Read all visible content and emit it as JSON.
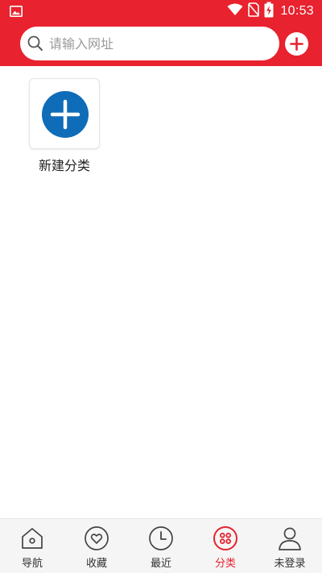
{
  "status_bar": {
    "time": "10:53",
    "icons": [
      "image-notification-icon",
      "wifi-icon",
      "no-sim-icon",
      "battery-charging-icon"
    ]
  },
  "search": {
    "placeholder": "请输入网址"
  },
  "content": {
    "new_category_label": "新建分类"
  },
  "bottom_nav": {
    "items": [
      {
        "label": "导航",
        "icon": "home-icon",
        "active": false
      },
      {
        "label": "收藏",
        "icon": "heart-icon",
        "active": false
      },
      {
        "label": "最近",
        "icon": "clock-icon",
        "active": false
      },
      {
        "label": "分类",
        "icon": "grid-icon",
        "active": true
      },
      {
        "label": "未登录",
        "icon": "user-icon",
        "active": false
      }
    ]
  },
  "colors": {
    "brand_red": "#e8222e",
    "accent_blue": "#0f6cb8",
    "nav_background": "#f5f5f5"
  }
}
